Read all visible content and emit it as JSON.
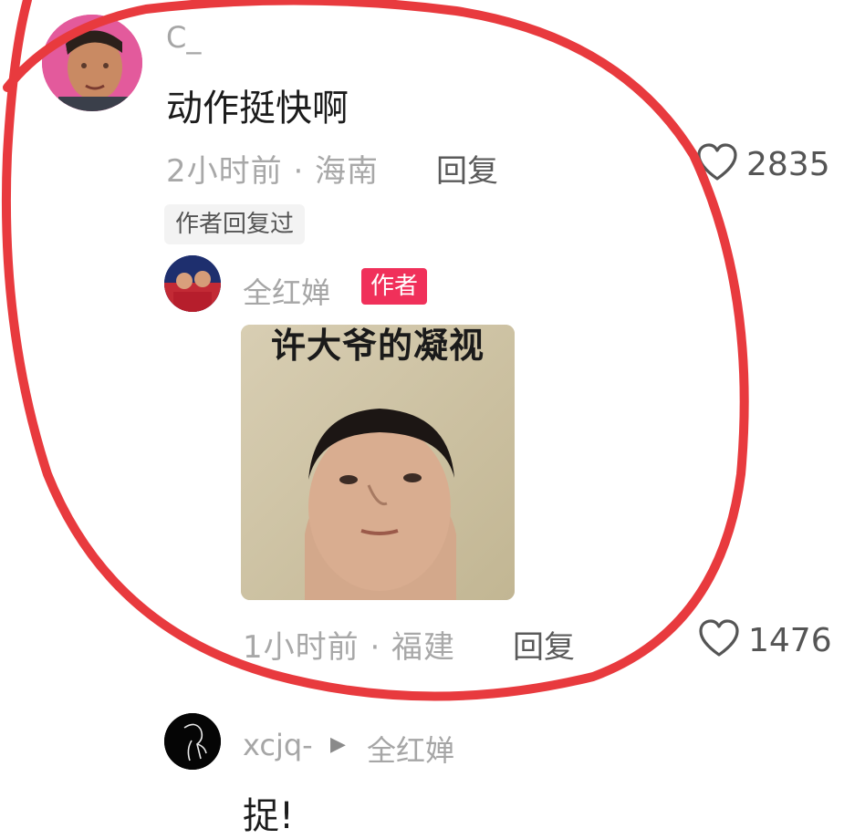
{
  "comment": {
    "username": "C_",
    "text": "动作挺快啊",
    "meta": "2小时前 · 海南",
    "reply_label": "回复",
    "like_count": "2835",
    "author_replied_tag": "作者回复过"
  },
  "reply": {
    "username": "全红婵",
    "author_badge": "作者",
    "sticker_caption": "许大爷的凝视",
    "meta": "1小时前 · 福建",
    "reply_label": "回复",
    "like_count": "1476"
  },
  "sub_reply": {
    "username": "xcjq-",
    "reply_to_arrow": "▶",
    "reply_to": "全红婵",
    "text": "捉!"
  },
  "colors": {
    "author_badge": "#f0305a",
    "annotation_ring": "#e83a3e"
  },
  "icons": [
    "heart-icon",
    "play-arrow-icon"
  ]
}
